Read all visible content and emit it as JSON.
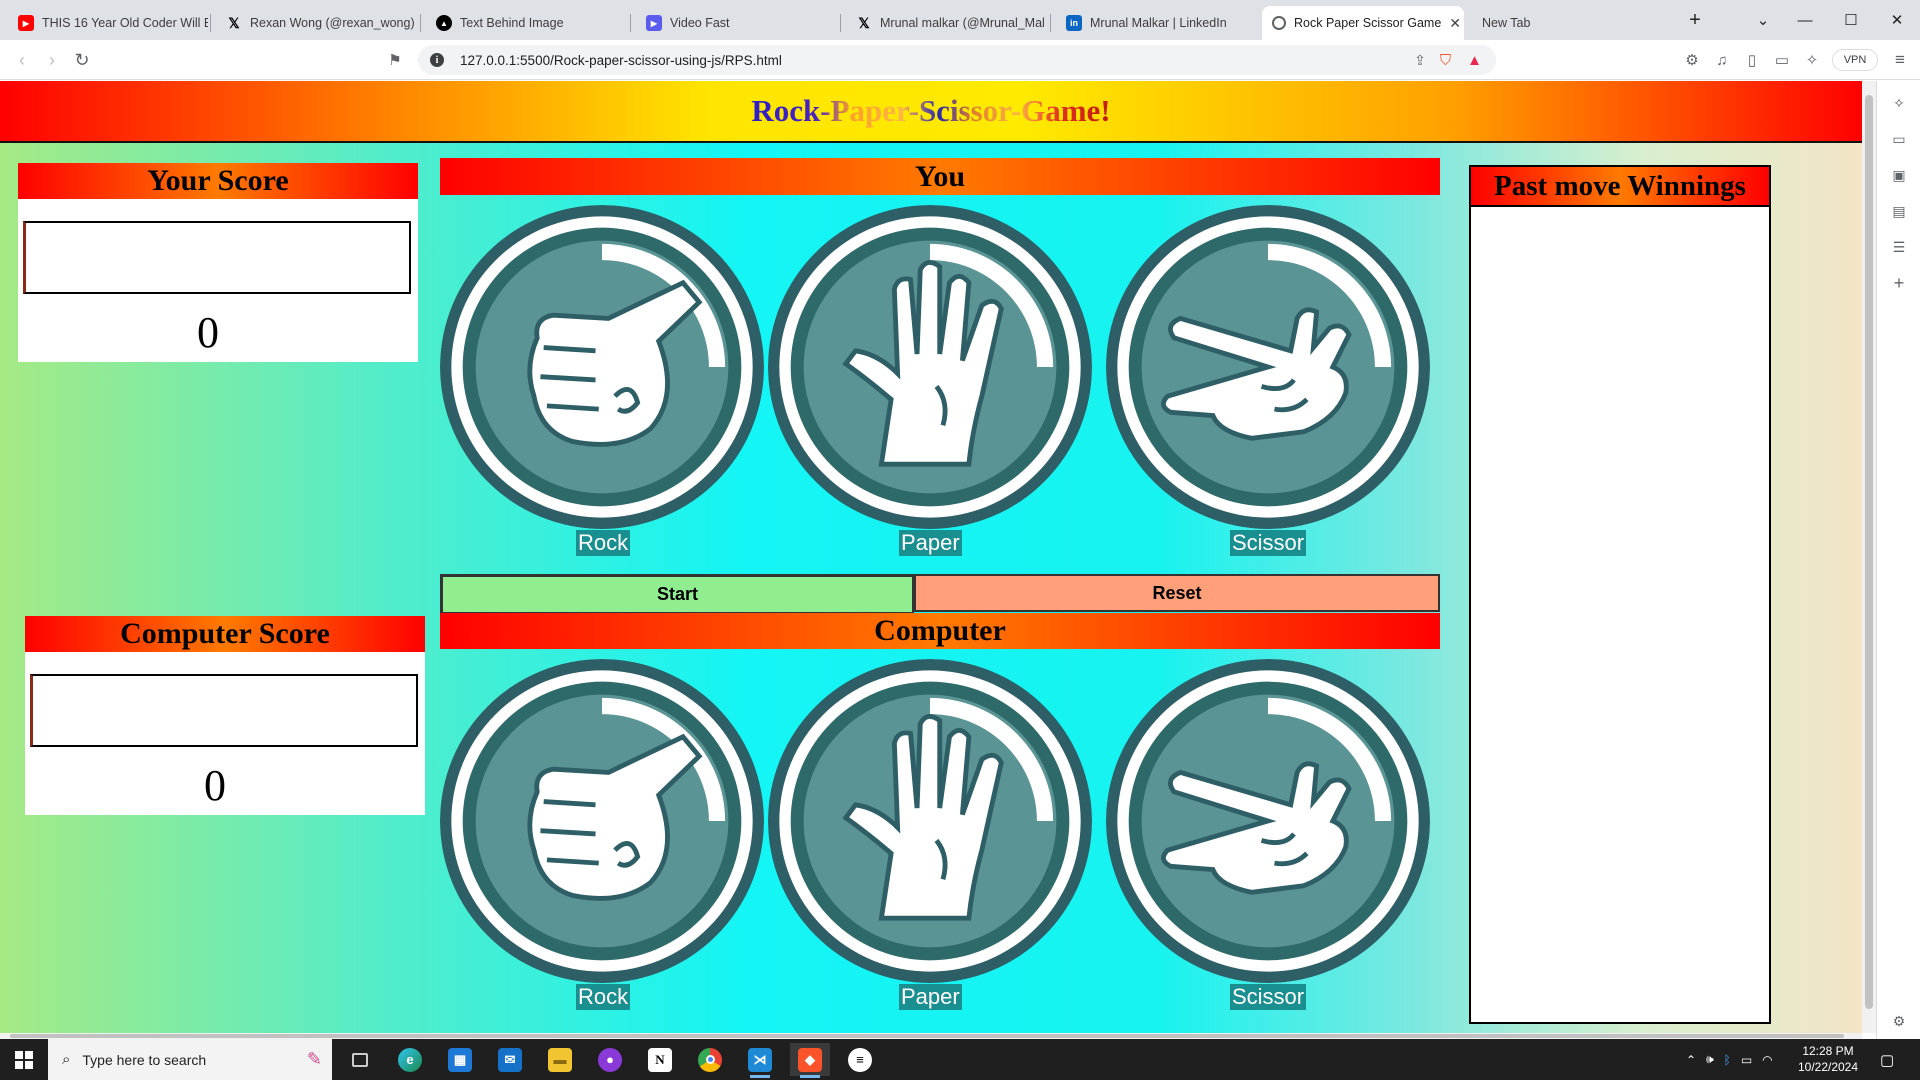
{
  "browser": {
    "tabs": [
      {
        "title": "THIS 16 Year Old Coder Will B",
        "favicon": "youtube-icon",
        "color": "#ff0000"
      },
      {
        "title": "Rexan Wong (@rexan_wong) /",
        "favicon": "x-icon",
        "color": "#000000"
      },
      {
        "title": "Text Behind Image",
        "favicon": "triangle-icon",
        "color": "#000000"
      },
      {
        "title": "Video Fast",
        "favicon": "play-icon",
        "color": "#5b5bf0"
      },
      {
        "title": "Mrunal malkar (@Mrunal_Mal",
        "favicon": "x-icon",
        "color": "#000000"
      },
      {
        "title": "Mrunal Malkar | LinkedIn",
        "favicon": "linkedin-icon",
        "color": "#0a66c2"
      },
      {
        "title": "Rock Paper Scissor Game",
        "favicon": "globe-icon",
        "color": "#5f6368",
        "active": true
      },
      {
        "title": "New Tab",
        "favicon": "",
        "color": ""
      }
    ],
    "new_tab": "+",
    "url": "127.0.0.1:5500/Rock-paper-scissor-using-js/RPS.html",
    "vpn_label": "VPN"
  },
  "game": {
    "title": "Rock-Paper-Scissor-Game!",
    "your_score_label": "Your Score",
    "your_score_value": "0",
    "computer_score_label": "Computer Score",
    "computer_score_value": "0",
    "you_label": "You",
    "computer_label": "Computer",
    "choices": [
      "Rock",
      "Paper",
      "Scissor"
    ],
    "start_label": "Start",
    "reset_label": "Reset",
    "history_label": "Past move Winnings",
    "colors": {
      "accent_red": "#ff0000",
      "accent_orange": "#ff7a00",
      "start": "#90ee90",
      "reset": "#ffa07a",
      "badge": "#1a8f8f",
      "icon_teal": "#2f6a6a"
    }
  },
  "taskbar": {
    "search_placeholder": "Type here to search",
    "time": "12:28 PM",
    "date": "10/22/2024"
  }
}
